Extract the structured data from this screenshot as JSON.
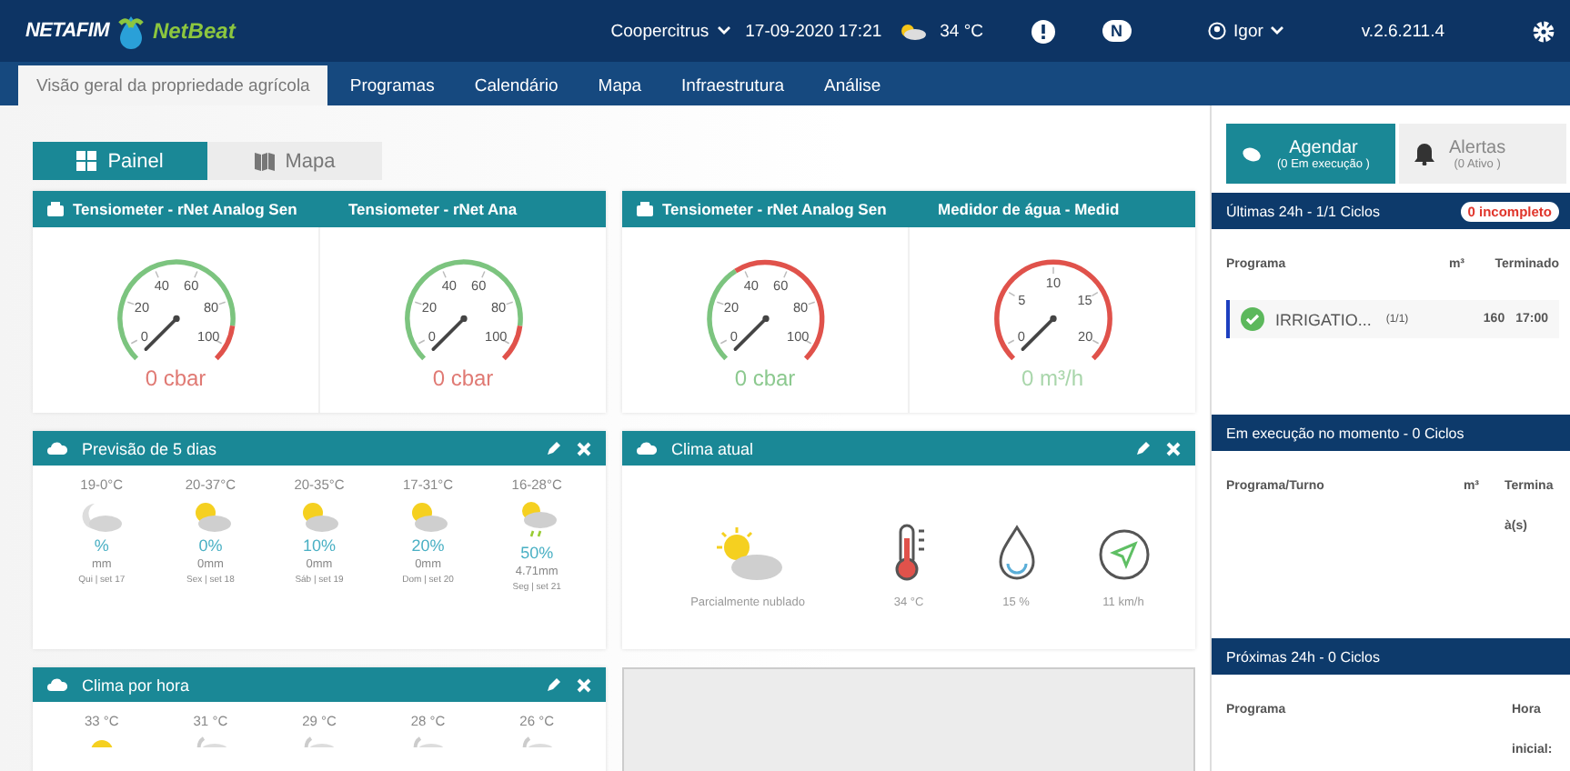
{
  "header": {
    "brand": "NETAFIM",
    "product": "NetBeat",
    "farm": "Coopercitrus",
    "datetime": "17-09-2020 17:21",
    "temperature": "34 °C",
    "cloud_badge": "N",
    "user": "Igor",
    "version": "v.2.6.211.4"
  },
  "tabs": [
    {
      "label": "Visão geral da propriedade agrícola",
      "selected": true
    },
    {
      "label": "Programas",
      "selected": false
    },
    {
      "label": "Calendário",
      "selected": false
    },
    {
      "label": "Mapa",
      "selected": false
    },
    {
      "label": "Infraestrutura",
      "selected": false
    },
    {
      "label": "Análise",
      "selected": false
    }
  ],
  "view_toggle": [
    {
      "label": "Painel",
      "selected": true,
      "kind": "panel"
    },
    {
      "label": "Mapa",
      "selected": false,
      "kind": "map"
    }
  ],
  "gauge_widgets": [
    {
      "gauges": [
        {
          "title": "Tensiometer - rNet Analog Sen",
          "kind": "tension",
          "ticks": [
            "0",
            "20",
            "40",
            "60",
            "80",
            "100"
          ],
          "value": "0 cbar",
          "color": "#e07a74"
        },
        {
          "title": "Tensiometer - rNet Ana",
          "kind": "tension",
          "ticks": [
            "0",
            "20",
            "40",
            "60",
            "80",
            "100"
          ],
          "value": "0 cbar",
          "color": "#e07a74"
        }
      ]
    },
    {
      "gauges": [
        {
          "title": "Tensiometer - rNet Analog Sen",
          "kind": "tension_dry",
          "ticks": [
            "0",
            "20",
            "40",
            "60",
            "80",
            "100"
          ],
          "value": "0 cbar",
          "color": "#8cc98f"
        },
        {
          "title": "Medidor de água - Medid",
          "kind": "flow",
          "ticks": [
            "0",
            "5",
            "10",
            "15",
            "20"
          ],
          "value": "0 m³/h",
          "color": "#a9d6ab"
        }
      ]
    }
  ],
  "forecast": {
    "title": "Previsão de 5 dias",
    "days": [
      {
        "temp": "19-0°C",
        "kind": "night",
        "chance": "%",
        "rain": "mm",
        "date": "Qui | set 17"
      },
      {
        "temp": "20-37°C",
        "kind": "sun_cloud",
        "chance": "0%",
        "rain": "0mm",
        "date": "Sex | set 18"
      },
      {
        "temp": "20-35°C",
        "kind": "sun_cloud",
        "chance": "10%",
        "rain": "0mm",
        "date": "Sáb | set 19"
      },
      {
        "temp": "17-31°C",
        "kind": "sun_cloud",
        "chance": "20%",
        "rain": "0mm",
        "date": "Dom | set 20"
      },
      {
        "temp": "16-28°C",
        "kind": "rain",
        "chance": "50%",
        "rain": "4.71mm",
        "date": "Seg | set 21"
      }
    ]
  },
  "current_weather": {
    "title": "Clima atual",
    "condition": "Parcialmente nublado",
    "temperature": "34 °C",
    "humidity": "15 %",
    "wind": "11 km/h"
  },
  "hourly": {
    "title": "Clima por hora",
    "hours": [
      {
        "temp": "33 °C",
        "kind": "sun"
      },
      {
        "temp": "31 °C",
        "kind": "night"
      },
      {
        "temp": "29 °C",
        "kind": "night"
      },
      {
        "temp": "28 °C",
        "kind": "night"
      },
      {
        "temp": "26 °C",
        "kind": "night"
      }
    ]
  },
  "side_tabs": [
    {
      "label": "Agendar",
      "sub": "(0 Em execução )",
      "selected": true,
      "kind": "schedule"
    },
    {
      "label": "Alertas",
      "sub": "(0 Ativo )",
      "selected": false,
      "kind": "alerts"
    }
  ],
  "sections": [
    {
      "title": "Últimas 24h - 1/1 Ciclos",
      "badge": "0 incompleto",
      "columns": [
        "Programa",
        "m³",
        "Terminado"
      ],
      "rows": [
        {
          "program": "IRRIGATIO...",
          "cycles": "(1/1)",
          "volume": "160",
          "time": "17:00"
        }
      ]
    },
    {
      "title": "Em execução no momento - 0 Ciclos",
      "columns": [
        "Programa/Turno",
        "m³",
        "Termina à(s)"
      ]
    },
    {
      "title": "Próximas 24h - 0 Ciclos",
      "columns": [
        "Programa",
        "Hora inicial:"
      ]
    }
  ]
}
